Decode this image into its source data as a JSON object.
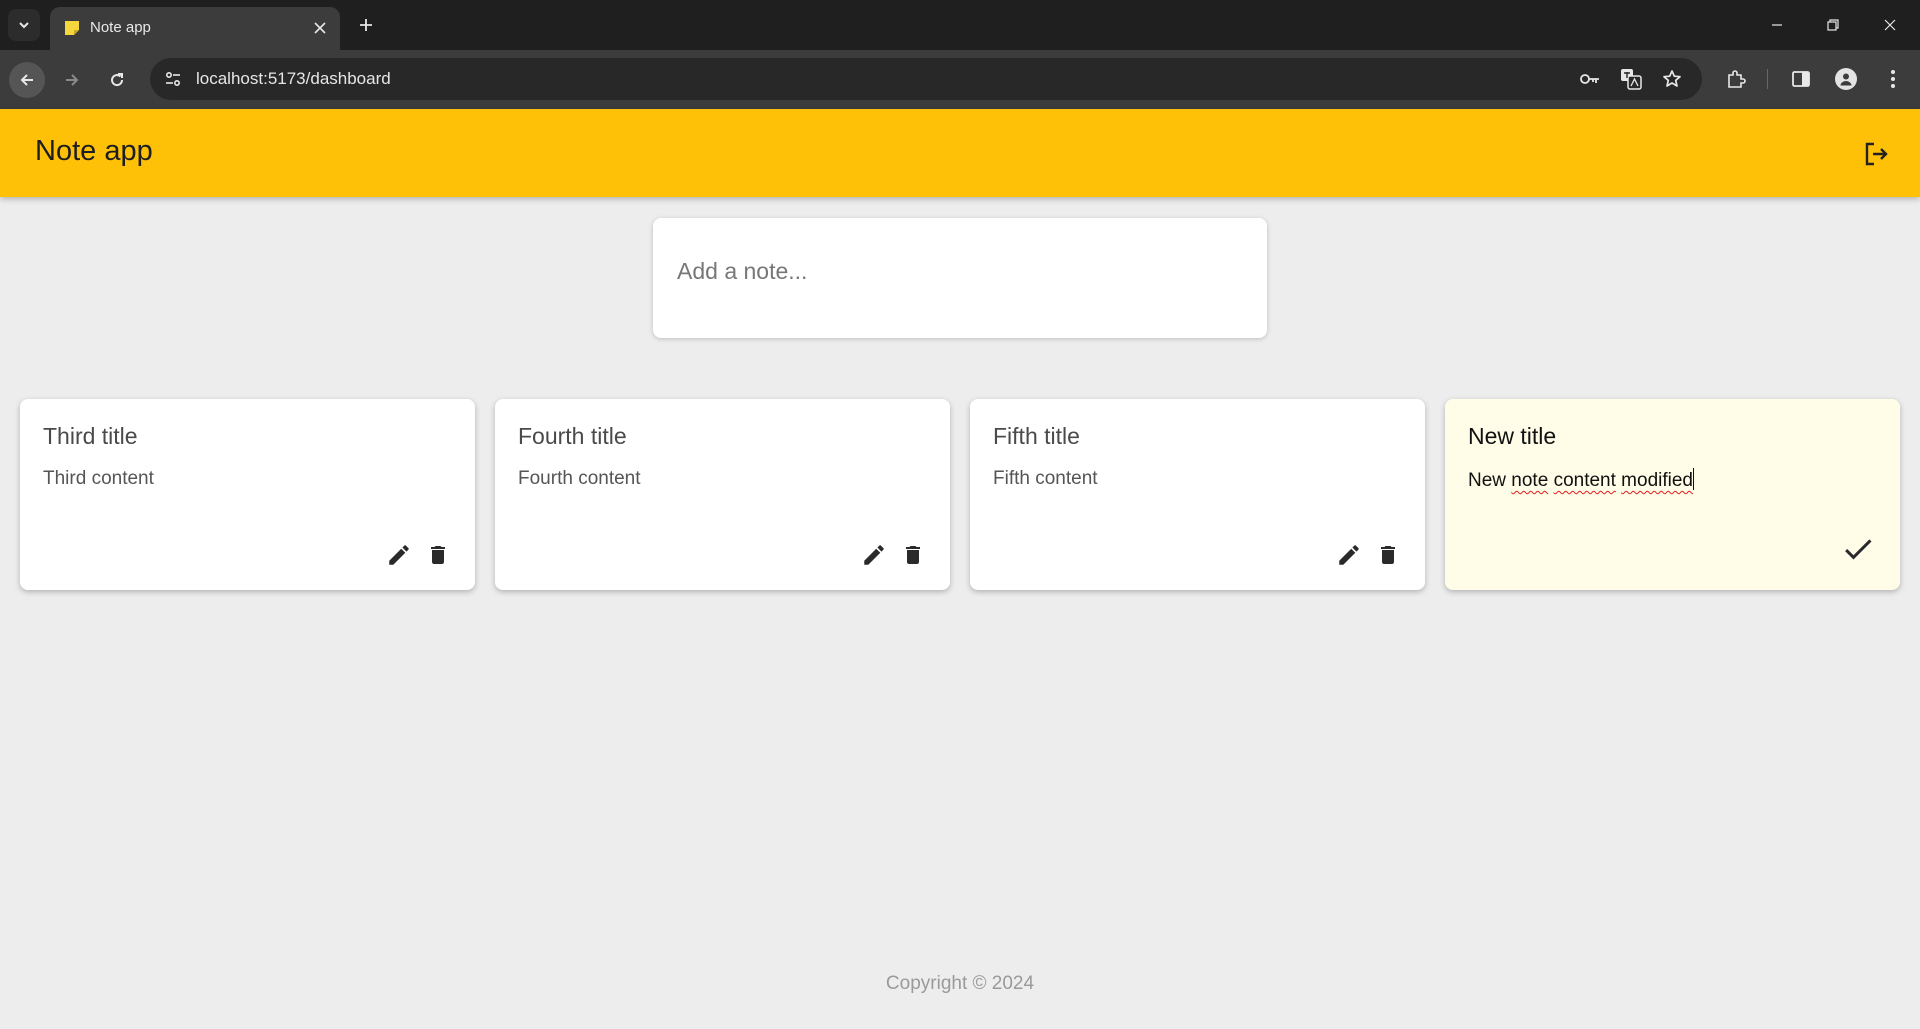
{
  "browser": {
    "tab_title": "Note app",
    "url": "localhost:5173/dashboard"
  },
  "app": {
    "title": "Note app",
    "compose_placeholder": "Add a note..."
  },
  "notes": [
    {
      "title": "Third title",
      "content": "Third content"
    },
    {
      "title": "Fourth title",
      "content": "Fourth content"
    },
    {
      "title": "Fifth title",
      "content": "Fifth content"
    }
  ],
  "editing_note": {
    "title": "New title",
    "content_parts": [
      "New ",
      "note",
      " ",
      "content",
      " ",
      "modified"
    ]
  },
  "footer": {
    "copyright": "Copyright © 2024"
  },
  "colors": {
    "header": "#ffc107",
    "background": "#ededed",
    "editing_card": "#fffde8"
  }
}
